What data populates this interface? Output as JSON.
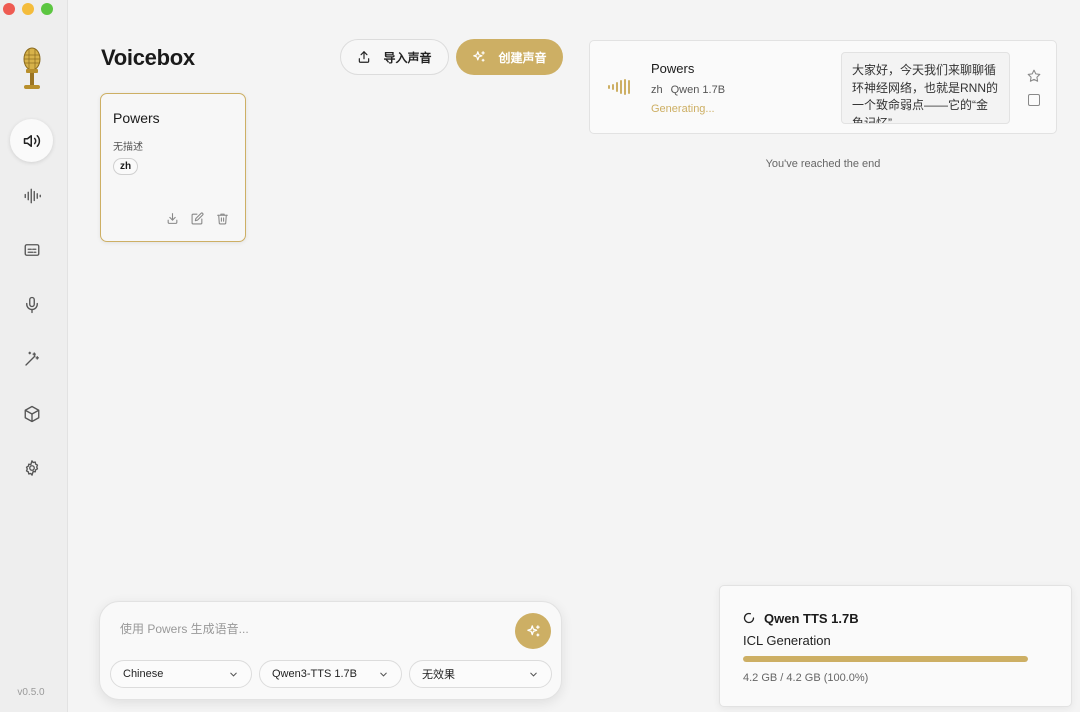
{
  "app": {
    "title": "Voicebox",
    "version": "v0.5.0"
  },
  "sidebar": {
    "items": [
      {
        "icon": "speaker-icon",
        "active": true
      },
      {
        "icon": "waveform-icon",
        "active": false
      },
      {
        "icon": "caption-icon",
        "active": false
      },
      {
        "icon": "microphone-icon",
        "active": false
      },
      {
        "icon": "magic-wand-icon",
        "active": false
      },
      {
        "icon": "cube-icon",
        "active": false
      },
      {
        "icon": "gear-icon",
        "active": false
      }
    ]
  },
  "toolbar": {
    "import_label": "导入声音",
    "create_label": "创建声音"
  },
  "voices": [
    {
      "name": "Powers",
      "description": "无描述",
      "language": "zh"
    }
  ],
  "history": {
    "items": [
      {
        "name": "Powers",
        "language": "zh",
        "model": "Qwen 1.7B",
        "status": "Generating...",
        "text": "大家好，今天我们来聊聊循环神经网络，也就是RNN的一个致命弱点——它的“金鱼记忆”"
      }
    ],
    "end_text": "You've reached the end"
  },
  "composer": {
    "placeholder": "使用 Powers 生成语音...",
    "language": "Chinese",
    "model": "Qwen3-TTS 1.7B",
    "effect": "无效果"
  },
  "model_status": {
    "name": "Qwen TTS 1.7B",
    "task": "ICL Generation",
    "progress": 1.0,
    "size_text": "4.2 GB / 4.2 GB (100.0%)"
  },
  "colors": {
    "accent": "#cdaf64",
    "background": "#f4f4f4",
    "sidebar": "#eeeeee"
  }
}
